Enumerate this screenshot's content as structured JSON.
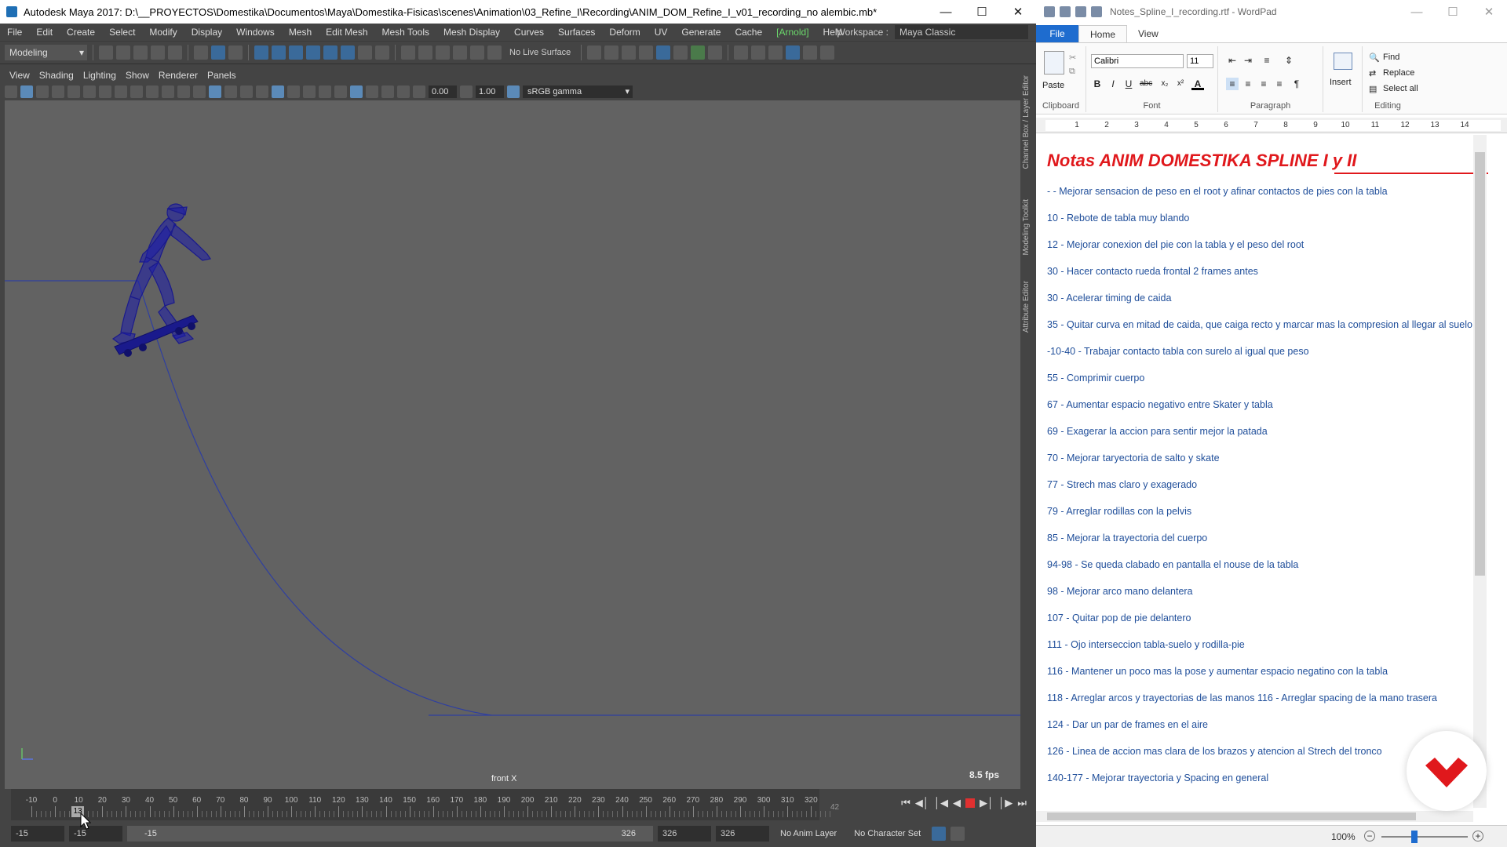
{
  "maya": {
    "title": "Autodesk Maya 2017: D:\\__PROYECTOS\\Domestika\\Documentos\\Maya\\Domestika-Fisicas\\scenes\\Animation\\03_Refine_I\\Recording\\ANIM_DOM_Refine_I_v01_recording_no alembic.mb*",
    "menu": [
      "File",
      "Edit",
      "Create",
      "Select",
      "Modify",
      "Display",
      "Windows",
      "Mesh",
      "Edit Mesh",
      "Mesh Tools",
      "Mesh Display",
      "Curves",
      "Surfaces",
      "Deform",
      "UV",
      "Generate",
      "Cache",
      "Arnold",
      "Help"
    ],
    "workspace_label": "Workspace :",
    "workspace_value": "Maya Classic",
    "mode": "Modeling",
    "live_surface": "No Live Surface",
    "viewport_menu": [
      "View",
      "Shading",
      "Lighting",
      "Show",
      "Renderer",
      "Panels"
    ],
    "field_a": "0.00",
    "field_b": "1.00",
    "color_space": "sRGB gamma",
    "camera_label": "front X",
    "fps": "8.5 fps",
    "side_tabs": [
      "Channel Box / Layer Editor",
      "Modeling Toolkit",
      "Attribute Editor"
    ],
    "timeline": {
      "tick_labels": [
        "-10",
        "0",
        "10",
        "20",
        "30",
        "40",
        "50",
        "60",
        "70",
        "80",
        "90",
        "100",
        "110",
        "120",
        "130",
        "140",
        "150",
        "160",
        "170",
        "180",
        "190",
        "200",
        "210",
        "220",
        "230",
        "240",
        "250",
        "260",
        "270",
        "280",
        "290",
        "300",
        "310",
        "320"
      ],
      "current_frame": "13",
      "end_hint": "42"
    },
    "range": {
      "start": "-15",
      "start2": "-15",
      "bar_start": "-15",
      "bar_end": "326",
      "end1": "326",
      "end2": "326",
      "anim_layer": "No Anim Layer",
      "char_set": "No Character Set"
    }
  },
  "wordpad": {
    "title": "Notes_Spline_I_recording.rtf - WordPad",
    "tabs": [
      "File",
      "Home",
      "View"
    ],
    "ribbon": {
      "paste": "Paste",
      "clipboard": "Clipboard",
      "font_name": "Calibri",
      "font_size": "11",
      "font_group": "Font",
      "paragraph_group": "Paragraph",
      "insert": "Insert",
      "find": "Find",
      "replace": "Replace",
      "select_all": "Select all",
      "editing_group": "Editing"
    },
    "ruler_numbers": [
      "1",
      "2",
      "3",
      "4",
      "5",
      "6",
      "7",
      "8",
      "9",
      "10",
      "11",
      "12",
      "13",
      "14"
    ],
    "doc_title": "Notas ANIM DOMESTIKA SPLINE I y II",
    "notes": [
      "- - Mejorar sensacion de peso en el root y afinar contactos de pies con la tabla",
      "10 - Rebote de tabla muy blando",
      "12 - Mejorar conexion del pie con la tabla y el peso del root",
      "30 - Hacer contacto rueda frontal 2 frames antes",
      "30 - Acelerar timing de caida",
      "35 - Quitar curva en mitad de caida, que caiga recto y marcar mas la compresion al llegar al suelo",
      "-10-40 - Trabajar contacto tabla con surelo al igual que peso",
      "55 - Comprimir cuerpo",
      "67 - Aumentar espacio negativo entre Skater y tabla",
      "69 - Exagerar la accion para sentir mejor la patada",
      "70 - Mejorar taryectoria de salto y skate",
      "77 - Strech mas claro y exagerado",
      "79 - Arreglar rodillas con la pelvis",
      "85 - Mejorar la trayectoria del cuerpo",
      "94-98 - Se queda clabado en pantalla el nouse de la tabla",
      "98 - Mejorar arco mano delantera",
      "107 - Quitar pop de pie delantero",
      "111 - Ojo interseccion tabla-suelo y rodilla-pie",
      "116 - Mantener un poco mas la pose y aumentar espacio negatino con la tabla",
      "118 - Arreglar arcos y trayectorias de las manos 116 - Arreglar spacing de la mano trasera",
      "124 - Dar un par de frames en el aire",
      "126 - Linea de accion mas clara de los brazos y atencion al Strech del tronco",
      "140-177 - Mejorar trayectoria y Spacing en general"
    ],
    "zoom": "100%",
    "zoom_level_percent": 100
  },
  "colors": {
    "maya_bg": "#444444",
    "viewport_bg": "#626262",
    "mesh_blue": "#1a1a8c",
    "note_text": "#1f4e9a",
    "title_red": "#e0181c",
    "arnold_green": "#6bd86b",
    "wordpad_accent": "#1e6ccf",
    "logo_red": "#e0181c"
  },
  "icons": [
    "maya-logo-icon",
    "minimize-icon",
    "maximize-icon",
    "close-icon",
    "save-icon",
    "undo-icon",
    "redo-icon",
    "camera-icon",
    "paste-icon",
    "find-icon",
    "replace-icon",
    "select-all-icon",
    "play-icon",
    "record-icon",
    "domestika-logo-icon",
    "mouse-cursor-icon"
  ]
}
